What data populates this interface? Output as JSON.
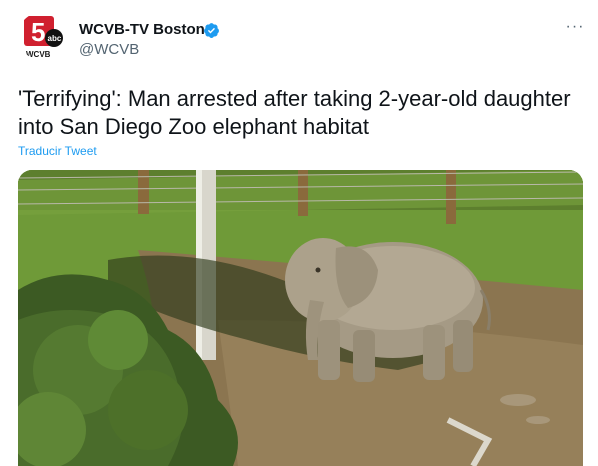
{
  "author": {
    "name": "WCVB-TV Boston",
    "handle": "@WCVB",
    "verified": true,
    "avatar_logo": "5",
    "avatar_network": "abc",
    "avatar_call_letters": "WCVB"
  },
  "tweet": {
    "text": "'Terrifying': Man arrested after taking 2-year-old daughter into San Diego Zoo elephant habitat",
    "translate_label": "Traducir Tweet"
  },
  "menu": {
    "more_label": "···"
  },
  "media": {
    "type": "photo",
    "subject": "elephant-in-enclosure"
  },
  "colors": {
    "brand_blue": "#1d9bf0",
    "text_primary": "#0f1419",
    "text_secondary": "#536471",
    "logo_red": "#d0202f"
  }
}
